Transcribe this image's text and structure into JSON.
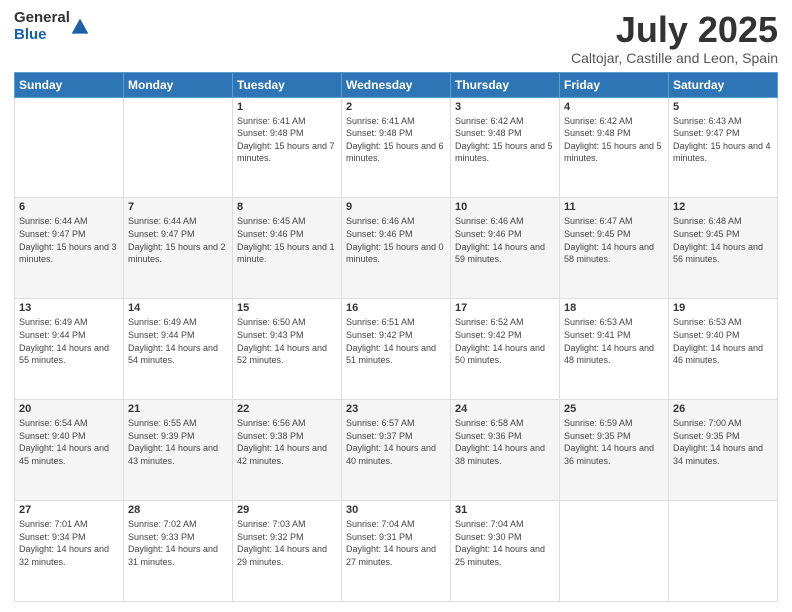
{
  "logo": {
    "general": "General",
    "blue": "Blue"
  },
  "title": "July 2025",
  "subtitle": "Caltojar, Castille and Leon, Spain",
  "days_of_week": [
    "Sunday",
    "Monday",
    "Tuesday",
    "Wednesday",
    "Thursday",
    "Friday",
    "Saturday"
  ],
  "weeks": [
    [
      {
        "day": "",
        "sunrise": "",
        "sunset": "",
        "daylight": ""
      },
      {
        "day": "",
        "sunrise": "",
        "sunset": "",
        "daylight": ""
      },
      {
        "day": "1",
        "sunrise": "Sunrise: 6:41 AM",
        "sunset": "Sunset: 9:48 PM",
        "daylight": "Daylight: 15 hours and 7 minutes."
      },
      {
        "day": "2",
        "sunrise": "Sunrise: 6:41 AM",
        "sunset": "Sunset: 9:48 PM",
        "daylight": "Daylight: 15 hours and 6 minutes."
      },
      {
        "day": "3",
        "sunrise": "Sunrise: 6:42 AM",
        "sunset": "Sunset: 9:48 PM",
        "daylight": "Daylight: 15 hours and 5 minutes."
      },
      {
        "day": "4",
        "sunrise": "Sunrise: 6:42 AM",
        "sunset": "Sunset: 9:48 PM",
        "daylight": "Daylight: 15 hours and 5 minutes."
      },
      {
        "day": "5",
        "sunrise": "Sunrise: 6:43 AM",
        "sunset": "Sunset: 9:47 PM",
        "daylight": "Daylight: 15 hours and 4 minutes."
      }
    ],
    [
      {
        "day": "6",
        "sunrise": "Sunrise: 6:44 AM",
        "sunset": "Sunset: 9:47 PM",
        "daylight": "Daylight: 15 hours and 3 minutes."
      },
      {
        "day": "7",
        "sunrise": "Sunrise: 6:44 AM",
        "sunset": "Sunset: 9:47 PM",
        "daylight": "Daylight: 15 hours and 2 minutes."
      },
      {
        "day": "8",
        "sunrise": "Sunrise: 6:45 AM",
        "sunset": "Sunset: 9:46 PM",
        "daylight": "Daylight: 15 hours and 1 minute."
      },
      {
        "day": "9",
        "sunrise": "Sunrise: 6:46 AM",
        "sunset": "Sunset: 9:46 PM",
        "daylight": "Daylight: 15 hours and 0 minutes."
      },
      {
        "day": "10",
        "sunrise": "Sunrise: 6:46 AM",
        "sunset": "Sunset: 9:46 PM",
        "daylight": "Daylight: 14 hours and 59 minutes."
      },
      {
        "day": "11",
        "sunrise": "Sunrise: 6:47 AM",
        "sunset": "Sunset: 9:45 PM",
        "daylight": "Daylight: 14 hours and 58 minutes."
      },
      {
        "day": "12",
        "sunrise": "Sunrise: 6:48 AM",
        "sunset": "Sunset: 9:45 PM",
        "daylight": "Daylight: 14 hours and 56 minutes."
      }
    ],
    [
      {
        "day": "13",
        "sunrise": "Sunrise: 6:49 AM",
        "sunset": "Sunset: 9:44 PM",
        "daylight": "Daylight: 14 hours and 55 minutes."
      },
      {
        "day": "14",
        "sunrise": "Sunrise: 6:49 AM",
        "sunset": "Sunset: 9:44 PM",
        "daylight": "Daylight: 14 hours and 54 minutes."
      },
      {
        "day": "15",
        "sunrise": "Sunrise: 6:50 AM",
        "sunset": "Sunset: 9:43 PM",
        "daylight": "Daylight: 14 hours and 52 minutes."
      },
      {
        "day": "16",
        "sunrise": "Sunrise: 6:51 AM",
        "sunset": "Sunset: 9:42 PM",
        "daylight": "Daylight: 14 hours and 51 minutes."
      },
      {
        "day": "17",
        "sunrise": "Sunrise: 6:52 AM",
        "sunset": "Sunset: 9:42 PM",
        "daylight": "Daylight: 14 hours and 50 minutes."
      },
      {
        "day": "18",
        "sunrise": "Sunrise: 6:53 AM",
        "sunset": "Sunset: 9:41 PM",
        "daylight": "Daylight: 14 hours and 48 minutes."
      },
      {
        "day": "19",
        "sunrise": "Sunrise: 6:53 AM",
        "sunset": "Sunset: 9:40 PM",
        "daylight": "Daylight: 14 hours and 46 minutes."
      }
    ],
    [
      {
        "day": "20",
        "sunrise": "Sunrise: 6:54 AM",
        "sunset": "Sunset: 9:40 PM",
        "daylight": "Daylight: 14 hours and 45 minutes."
      },
      {
        "day": "21",
        "sunrise": "Sunrise: 6:55 AM",
        "sunset": "Sunset: 9:39 PM",
        "daylight": "Daylight: 14 hours and 43 minutes."
      },
      {
        "day": "22",
        "sunrise": "Sunrise: 6:56 AM",
        "sunset": "Sunset: 9:38 PM",
        "daylight": "Daylight: 14 hours and 42 minutes."
      },
      {
        "day": "23",
        "sunrise": "Sunrise: 6:57 AM",
        "sunset": "Sunset: 9:37 PM",
        "daylight": "Daylight: 14 hours and 40 minutes."
      },
      {
        "day": "24",
        "sunrise": "Sunrise: 6:58 AM",
        "sunset": "Sunset: 9:36 PM",
        "daylight": "Daylight: 14 hours and 38 minutes."
      },
      {
        "day": "25",
        "sunrise": "Sunrise: 6:59 AM",
        "sunset": "Sunset: 9:35 PM",
        "daylight": "Daylight: 14 hours and 36 minutes."
      },
      {
        "day": "26",
        "sunrise": "Sunrise: 7:00 AM",
        "sunset": "Sunset: 9:35 PM",
        "daylight": "Daylight: 14 hours and 34 minutes."
      }
    ],
    [
      {
        "day": "27",
        "sunrise": "Sunrise: 7:01 AM",
        "sunset": "Sunset: 9:34 PM",
        "daylight": "Daylight: 14 hours and 32 minutes."
      },
      {
        "day": "28",
        "sunrise": "Sunrise: 7:02 AM",
        "sunset": "Sunset: 9:33 PM",
        "daylight": "Daylight: 14 hours and 31 minutes."
      },
      {
        "day": "29",
        "sunrise": "Sunrise: 7:03 AM",
        "sunset": "Sunset: 9:32 PM",
        "daylight": "Daylight: 14 hours and 29 minutes."
      },
      {
        "day": "30",
        "sunrise": "Sunrise: 7:04 AM",
        "sunset": "Sunset: 9:31 PM",
        "daylight": "Daylight: 14 hours and 27 minutes."
      },
      {
        "day": "31",
        "sunrise": "Sunrise: 7:04 AM",
        "sunset": "Sunset: 9:30 PM",
        "daylight": "Daylight: 14 hours and 25 minutes."
      },
      {
        "day": "",
        "sunrise": "",
        "sunset": "",
        "daylight": ""
      },
      {
        "day": "",
        "sunrise": "",
        "sunset": "",
        "daylight": ""
      }
    ]
  ]
}
